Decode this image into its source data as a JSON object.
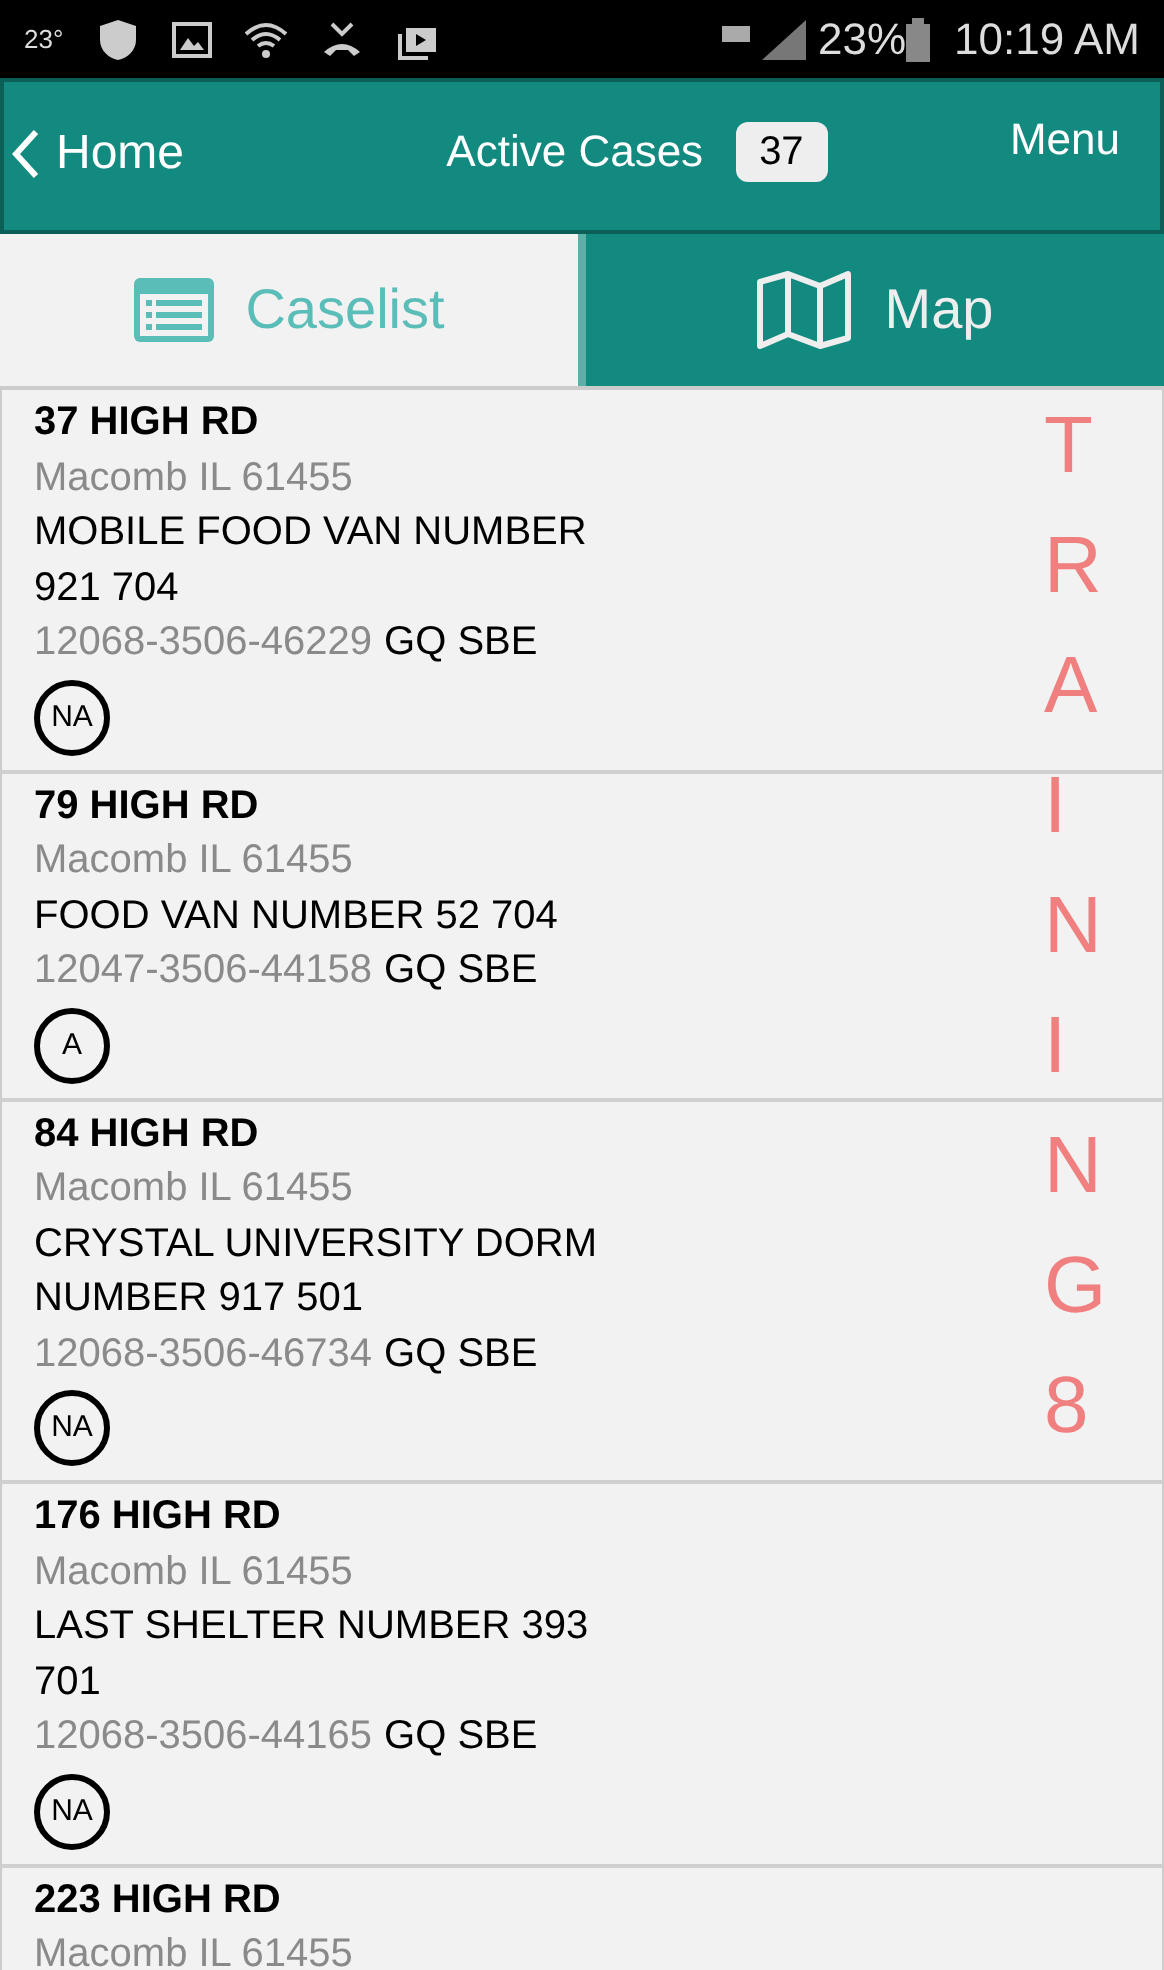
{
  "status_bar": {
    "temperature": "23°",
    "battery_percent": "23%",
    "time": "10:19 AM"
  },
  "header": {
    "back_label": "Home",
    "title": "Active Cases",
    "count": "37",
    "menu_label": "Menu"
  },
  "tabs": [
    {
      "label": "Caselist",
      "selected": true
    },
    {
      "label": "Map",
      "selected": false
    }
  ],
  "cases": [
    {
      "street": "37 HIGH RD",
      "city": "Macomb IL 61455",
      "description_lines": [
        "MOBILE FOOD VAN NUMBER",
        "921 704"
      ],
      "case_id": "12068-3506-46229",
      "type": "GQ SBE",
      "status": "NA"
    },
    {
      "street": "79 HIGH RD",
      "city": "Macomb IL 61455",
      "description_lines": [
        "FOOD VAN NUMBER 52 704"
      ],
      "case_id": "12047-3506-44158",
      "type": "GQ SBE",
      "status": "A"
    },
    {
      "street": "84 HIGH RD",
      "city": "Macomb IL 61455",
      "description_lines": [
        "CRYSTAL UNIVERSITY DORM",
        "NUMBER 917 501"
      ],
      "case_id": "12068-3506-46734",
      "type": "GQ SBE",
      "status": "NA"
    },
    {
      "street": "176 HIGH RD",
      "city": "Macomb IL 61455",
      "description_lines": [
        "LAST SHELTER NUMBER 393",
        "701"
      ],
      "case_id": "12068-3506-44165",
      "type": "GQ SBE",
      "status": "NA"
    },
    {
      "street": "223 HIGH RD",
      "city": "Macomb IL 61455"
    }
  ],
  "mode_banner": "TRAINING8"
}
